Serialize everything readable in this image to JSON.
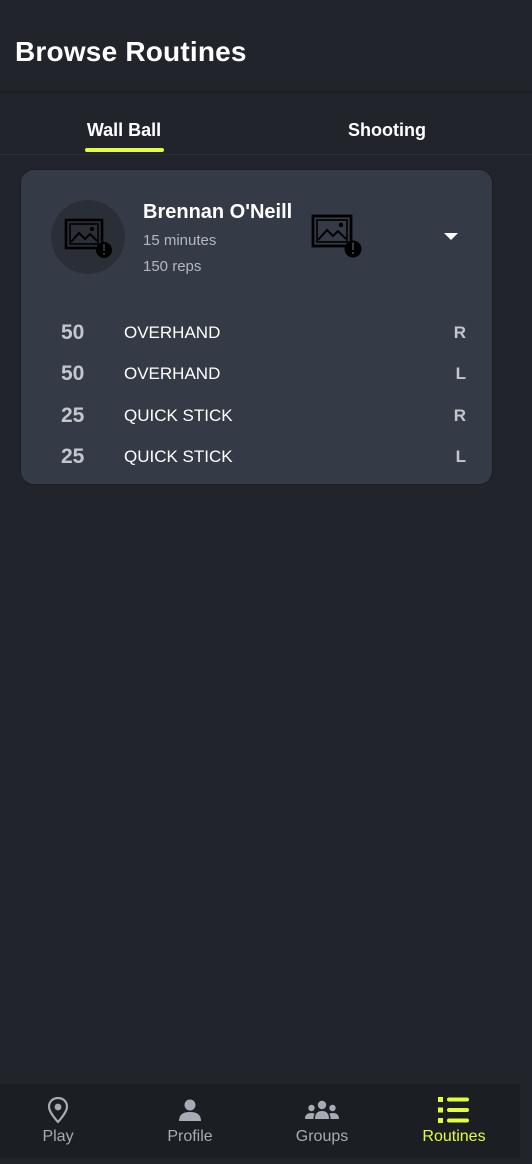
{
  "header": {
    "title": "Browse Routines"
  },
  "tabs": [
    {
      "label": "Wall Ball",
      "active": true
    },
    {
      "label": "Shooting",
      "active": false
    }
  ],
  "routine": {
    "name": "Brennan O'Neill",
    "duration": "15 minutes",
    "reps": "150 reps",
    "exercises": [
      {
        "count": "50",
        "name": "OVERHAND",
        "side": "R"
      },
      {
        "count": "50",
        "name": "OVERHAND",
        "side": "L"
      },
      {
        "count": "25",
        "name": "QUICK STICK",
        "side": "R"
      },
      {
        "count": "25",
        "name": "QUICK STICK",
        "side": "L"
      }
    ]
  },
  "nav": [
    {
      "label": "Play",
      "icon": "location-pin-icon",
      "active": false
    },
    {
      "label": "Profile",
      "icon": "person-icon",
      "active": false
    },
    {
      "label": "Groups",
      "icon": "group-icon",
      "active": false
    },
    {
      "label": "Routines",
      "icon": "list-icon",
      "active": true
    }
  ],
  "colors": {
    "background": "#21252b",
    "card": "#353b46",
    "accent": "#e3ff3b",
    "muted_text": "#b3b8c0"
  }
}
